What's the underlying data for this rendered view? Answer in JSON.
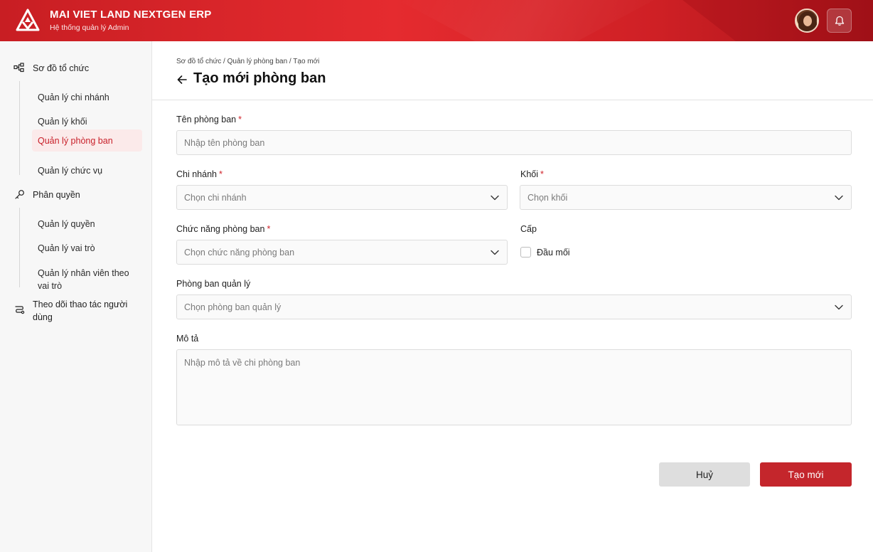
{
  "app": {
    "title": "MAI VIET LAND NEXTGEN ERP",
    "subtitle": "Hệ thống quản lý Admin"
  },
  "header": {
    "avatar_icon": "user-avatar",
    "notification_icon": "bell-icon"
  },
  "sidebar": {
    "groups": [
      {
        "label": "Sơ đồ tổ chức",
        "icon": "org-chart-icon",
        "items": [
          {
            "label": "Quản lý chi nhánh"
          },
          {
            "label": "Quản lý khối"
          },
          {
            "label": "Quản lý phòng ban",
            "active": true
          },
          {
            "label": "Quản lý chức vụ"
          }
        ]
      },
      {
        "label": "Phân quyền",
        "icon": "key-icon",
        "items": [
          {
            "label": "Quản lý quyền"
          },
          {
            "label": "Quản lý vai trò"
          },
          {
            "label": "Quản lý nhân viên theo vai trò"
          }
        ]
      },
      {
        "label": "Theo dõi thao tác người dùng",
        "icon": "route-icon",
        "items": []
      }
    ]
  },
  "page": {
    "breadcrumb": "Sơ đồ tổ chức / Quản lý phòng ban / Tạo mới",
    "title": "Tạo mới phòng ban"
  },
  "form": {
    "name": {
      "label": "Tên phòng ban",
      "placeholder": "Nhập tên phòng ban",
      "required": "*"
    },
    "branch": {
      "label": "Chi nhánh",
      "placeholder": "Chọn chi nhánh",
      "required": "*"
    },
    "block": {
      "label": "Khối",
      "placeholder": "Chọn khối",
      "required": "*"
    },
    "function": {
      "label": "Chức năng phòng ban",
      "placeholder": "Chọn chức năng phòng ban",
      "required": "*"
    },
    "level": {
      "label": "Cấp",
      "checkbox_label": "Đầu mối",
      "checked": false
    },
    "manager_dept": {
      "label": "Phòng ban quản lý",
      "placeholder": "Chọn phòng ban quản lý"
    },
    "description": {
      "label": "Mô tả",
      "placeholder": "Nhập mô tả về chi phòng ban"
    }
  },
  "actions": {
    "cancel_label": "Huỷ",
    "create_label": "Tạo mới"
  },
  "colors": {
    "brand": "#d8242a",
    "active_text": "#c8202a",
    "active_bg": "#fbeaea",
    "primary_button": "#c4262c"
  }
}
